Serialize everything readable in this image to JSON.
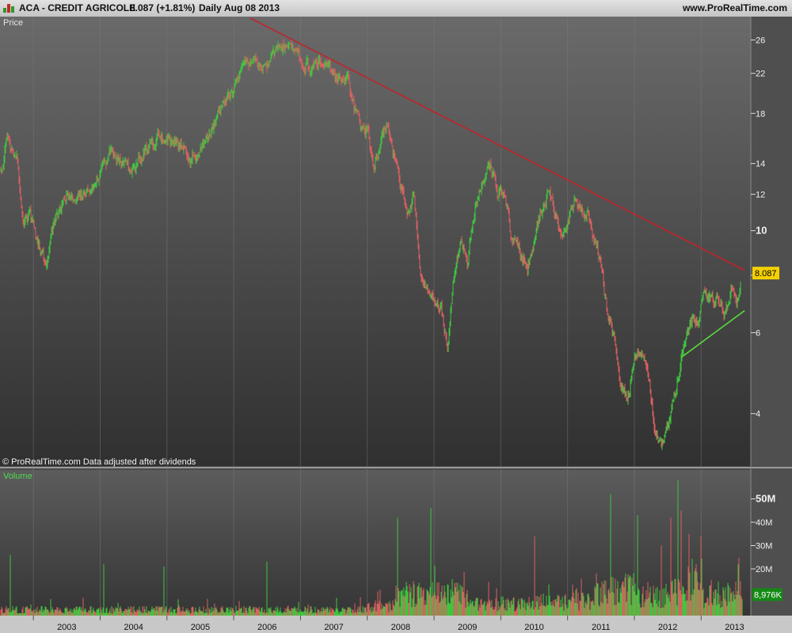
{
  "header": {
    "ticker": "ACA - CREDIT AGRICOLE",
    "quote": "8.087 (+1.81%)",
    "period": "Daily",
    "date": "Aug 08 2013",
    "site": "www.ProRealTime.com"
  },
  "panels": {
    "price_label": "Price",
    "volume_label": "Volume",
    "copyright": "© ProRealTime.com Data adjusted after dividends"
  },
  "colors": {
    "up": "#3fc63f",
    "down": "#d96060",
    "resistance": "#c0242a",
    "support": "#58e03a",
    "last_price_badge": "#f5d000",
    "volume_badge": "#148a14"
  },
  "chart_data": [
    {
      "type": "line",
      "panel": "price",
      "label": "Price",
      "scale": "log",
      "ylim": [
        3.1,
        29
      ],
      "y_ticks": [
        4,
        6,
        8,
        10,
        12,
        14,
        18,
        22,
        26
      ],
      "y_ticks_major": [
        10
      ],
      "x_labels": [
        "2003",
        "2004",
        "2005",
        "2006",
        "2007",
        "2008",
        "2009",
        "2010",
        "2011",
        "2012",
        "2013"
      ],
      "last_price": "8.087",
      "series": [
        {
          "name": "ACA - CREDIT AGRICOLE",
          "points": [
            [
              2002.5,
              13.0
            ],
            [
              2002.6,
              15.6
            ],
            [
              2002.75,
              14.5
            ],
            [
              2002.85,
              10.5
            ],
            [
              2002.95,
              10.8
            ],
            [
              2003.05,
              9.5
            ],
            [
              2003.15,
              8.9
            ],
            [
              2003.2,
              8.3
            ],
            [
              2003.3,
              10.3
            ],
            [
              2003.45,
              11.8
            ],
            [
              2003.6,
              12.0
            ],
            [
              2003.75,
              12.0
            ],
            [
              2003.9,
              12.6
            ],
            [
              2004.0,
              13.5
            ],
            [
              2004.15,
              14.8
            ],
            [
              2004.3,
              14.0
            ],
            [
              2004.45,
              13.5
            ],
            [
              2004.6,
              14.2
            ],
            [
              2004.75,
              15.5
            ],
            [
              2004.9,
              16.0
            ],
            [
              2005.05,
              15.5
            ],
            [
              2005.2,
              15.3
            ],
            [
              2005.35,
              14.5
            ],
            [
              2005.5,
              15.0
            ],
            [
              2005.6,
              16.0
            ],
            [
              2005.75,
              17.5
            ],
            [
              2005.9,
              19.5
            ],
            [
              2006.05,
              21.0
            ],
            [
              2006.15,
              23.0
            ],
            [
              2006.3,
              24.0
            ],
            [
              2006.4,
              23.0
            ],
            [
              2006.5,
              22.5
            ],
            [
              2006.65,
              24.5
            ],
            [
              2006.75,
              25.5
            ],
            [
              2006.85,
              25.0
            ],
            [
              2006.95,
              24.5
            ],
            [
              2007.05,
              23.0
            ],
            [
              2007.15,
              22.5
            ],
            [
              2007.3,
              23.5
            ],
            [
              2007.4,
              23.0
            ],
            [
              2007.5,
              22.0
            ],
            [
              2007.6,
              21.0
            ],
            [
              2007.7,
              21.5
            ],
            [
              2007.8,
              18.5
            ],
            [
              2007.9,
              17.0
            ],
            [
              2008.0,
              16.5
            ],
            [
              2008.1,
              14.0
            ],
            [
              2008.2,
              15.5
            ],
            [
              2008.3,
              17.0
            ],
            [
              2008.4,
              14.5
            ],
            [
              2008.5,
              12.5
            ],
            [
              2008.6,
              11.0
            ],
            [
              2008.7,
              12.0
            ],
            [
              2008.75,
              9.8
            ],
            [
              2008.8,
              8.0
            ],
            [
              2008.9,
              7.5
            ],
            [
              2009.0,
              7.0
            ],
            [
              2009.1,
              6.8
            ],
            [
              2009.2,
              5.6
            ],
            [
              2009.3,
              8.0
            ],
            [
              2009.4,
              9.5
            ],
            [
              2009.5,
              8.5
            ],
            [
              2009.6,
              11.0
            ],
            [
              2009.75,
              13.0
            ],
            [
              2009.85,
              14.0
            ],
            [
              2009.95,
              12.0
            ],
            [
              2010.05,
              12.5
            ],
            [
              2010.15,
              9.8
            ],
            [
              2010.3,
              9.0
            ],
            [
              2010.4,
              8.3
            ],
            [
              2010.5,
              9.5
            ],
            [
              2010.6,
              11.0
            ],
            [
              2010.7,
              12.0
            ],
            [
              2010.8,
              11.2
            ],
            [
              2010.9,
              9.5
            ],
            [
              2011.0,
              10.5
            ],
            [
              2011.1,
              11.8
            ],
            [
              2011.2,
              11.0
            ],
            [
              2011.3,
              10.8
            ],
            [
              2011.4,
              9.6
            ],
            [
              2011.5,
              8.5
            ],
            [
              2011.6,
              6.5
            ],
            [
              2011.7,
              5.8
            ],
            [
              2011.8,
              4.6
            ],
            [
              2011.9,
              4.3
            ],
            [
              2012.0,
              5.2
            ],
            [
              2012.1,
              5.5
            ],
            [
              2012.2,
              4.9
            ],
            [
              2012.3,
              3.8
            ],
            [
              2012.4,
              3.4
            ],
            [
              2012.45,
              3.6
            ],
            [
              2012.55,
              4.0
            ],
            [
              2012.65,
              4.8
            ],
            [
              2012.75,
              5.8
            ],
            [
              2012.85,
              6.3
            ],
            [
              2012.95,
              6.4
            ],
            [
              2013.05,
              7.3
            ],
            [
              2013.15,
              7.0
            ],
            [
              2013.25,
              7.2
            ],
            [
              2013.35,
              6.6
            ],
            [
              2013.45,
              7.3
            ],
            [
              2013.55,
              6.9
            ],
            [
              2013.6,
              8.087
            ]
          ]
        }
      ],
      "trendlines": [
        {
          "role": "resistance",
          "from": [
            2006.25,
            29.0
          ],
          "to": [
            2013.65,
            8.2
          ]
        },
        {
          "role": "support",
          "from": [
            2012.7,
            5.3
          ],
          "to": [
            2013.65,
            6.7
          ]
        }
      ]
    },
    {
      "type": "bar",
      "panel": "volume",
      "label": "Volume",
      "ylim": [
        0,
        60
      ],
      "y_ticks": [
        20,
        30,
        40,
        50
      ],
      "y_tick_labels": [
        "20M",
        "30M",
        "40M",
        "50M"
      ],
      "y_ticks_major": [
        50
      ],
      "last_volume": "8,976K",
      "unit": "M",
      "regimes": [
        [
          2002.5,
          2.5
        ],
        [
          2008.0,
          4.0
        ],
        [
          2008.4,
          9.0
        ],
        [
          2009.5,
          5.0
        ],
        [
          2010.5,
          6.0
        ],
        [
          2011.4,
          11.0
        ],
        [
          2012.0,
          9.0
        ],
        [
          2012.5,
          10.0
        ],
        [
          2012.7,
          15.0
        ],
        [
          2013.0,
          9.0
        ],
        [
          2013.7,
          9.0
        ]
      ],
      "spikes": [
        [
          2002.65,
          26
        ],
        [
          2004.05,
          22
        ],
        [
          2004.95,
          21
        ],
        [
          2006.5,
          23
        ],
        [
          2008.45,
          42
        ],
        [
          2008.95,
          46
        ],
        [
          2010.5,
          34
        ],
        [
          2011.65,
          52
        ],
        [
          2012.05,
          43
        ],
        [
          2012.4,
          30
        ],
        [
          2012.55,
          42
        ],
        [
          2012.65,
          58
        ],
        [
          2012.7,
          45
        ],
        [
          2013.0,
          34
        ],
        [
          2013.55,
          22
        ],
        [
          2013.62,
          23
        ]
      ]
    }
  ]
}
